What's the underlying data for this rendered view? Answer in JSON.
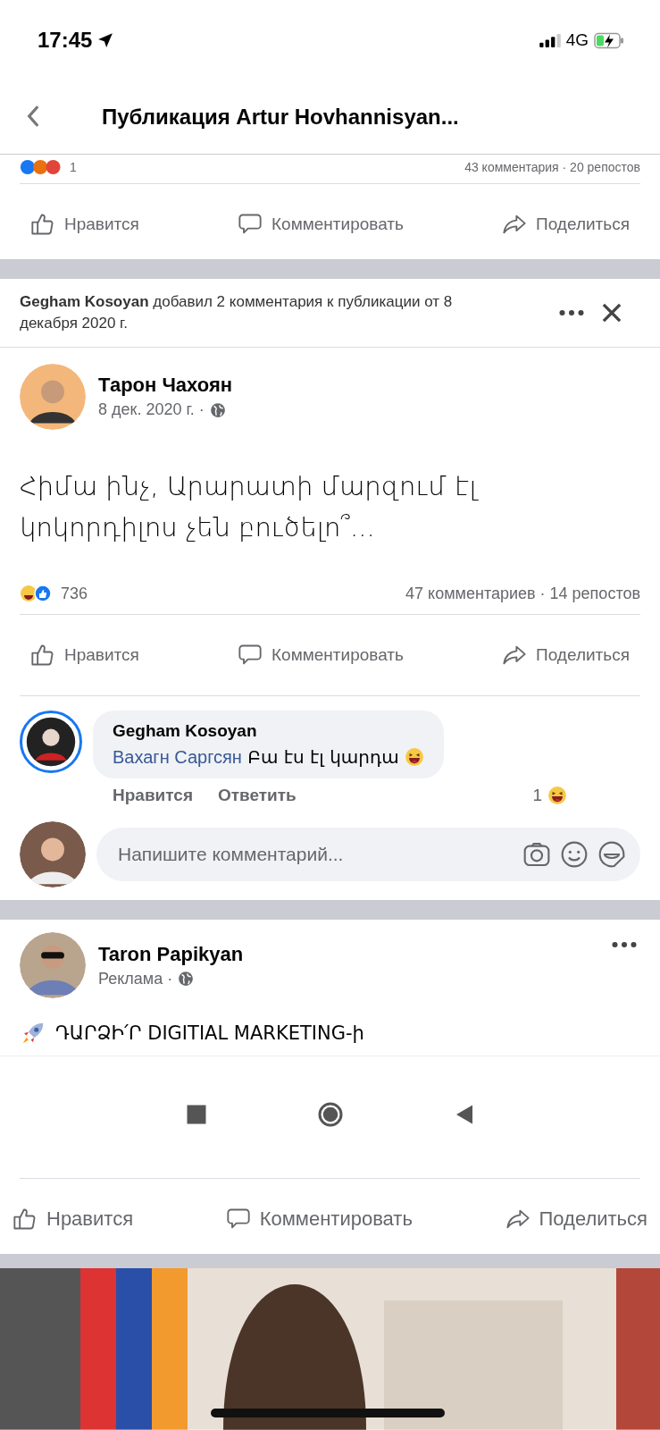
{
  "status_bar": {
    "time": "17:45",
    "network": "4G"
  },
  "nav": {
    "title": "Публикация Artur Hovhannisyan..."
  },
  "previous_post": {
    "reaction_count": "1",
    "stats": "43 комментария · 20 репостов",
    "actions": [
      {
        "kind": "like",
        "label": "Нравится"
      },
      {
        "kind": "comment",
        "label": "Комментировать"
      },
      {
        "kind": "share",
        "label": "Поделиться"
      }
    ]
  },
  "notice": {
    "text": "**Gegham Kosoyan** добавил 2 комментария к публикации от 8 декабря 2020 г."
  },
  "post": {
    "author": "Тарон Чахоян",
    "meta": "8 дек. 2020 г. ·",
    "text": "Հիմա  ինչ, Արարատի մարզում էլ կոկորդիլոս չեն բուծելո՞...",
    "reaction_count": "736",
    "stats": "47 комментариев · 14 репостов",
    "actions": [
      {
        "kind": "like",
        "label": "Нравится"
      },
      {
        "kind": "comment",
        "label": "Комментировать"
      },
      {
        "kind": "share",
        "label": "Поделиться"
      }
    ]
  },
  "comment": {
    "author": "Gegham Kosoyan",
    "mention": "Вахагн Саргсян",
    "text": "Բա էս էլ կարդա",
    "like": "Нравится",
    "reply": "Ответить",
    "reaction_count": "1"
  },
  "composer": {
    "placeholder": "Напишите комментарий..."
  },
  "ad": {
    "author": "Taron Papikyan",
    "meta": "Реклама ·",
    "text": "ԴԱՐՁԻ՛Ր DIGITIAL MARKETING-ի",
    "actions": [
      {
        "kind": "like",
        "label": "Нравится"
      },
      {
        "kind": "comment",
        "label": "Комментировать"
      },
      {
        "kind": "share",
        "label": "Поделиться"
      }
    ]
  }
}
